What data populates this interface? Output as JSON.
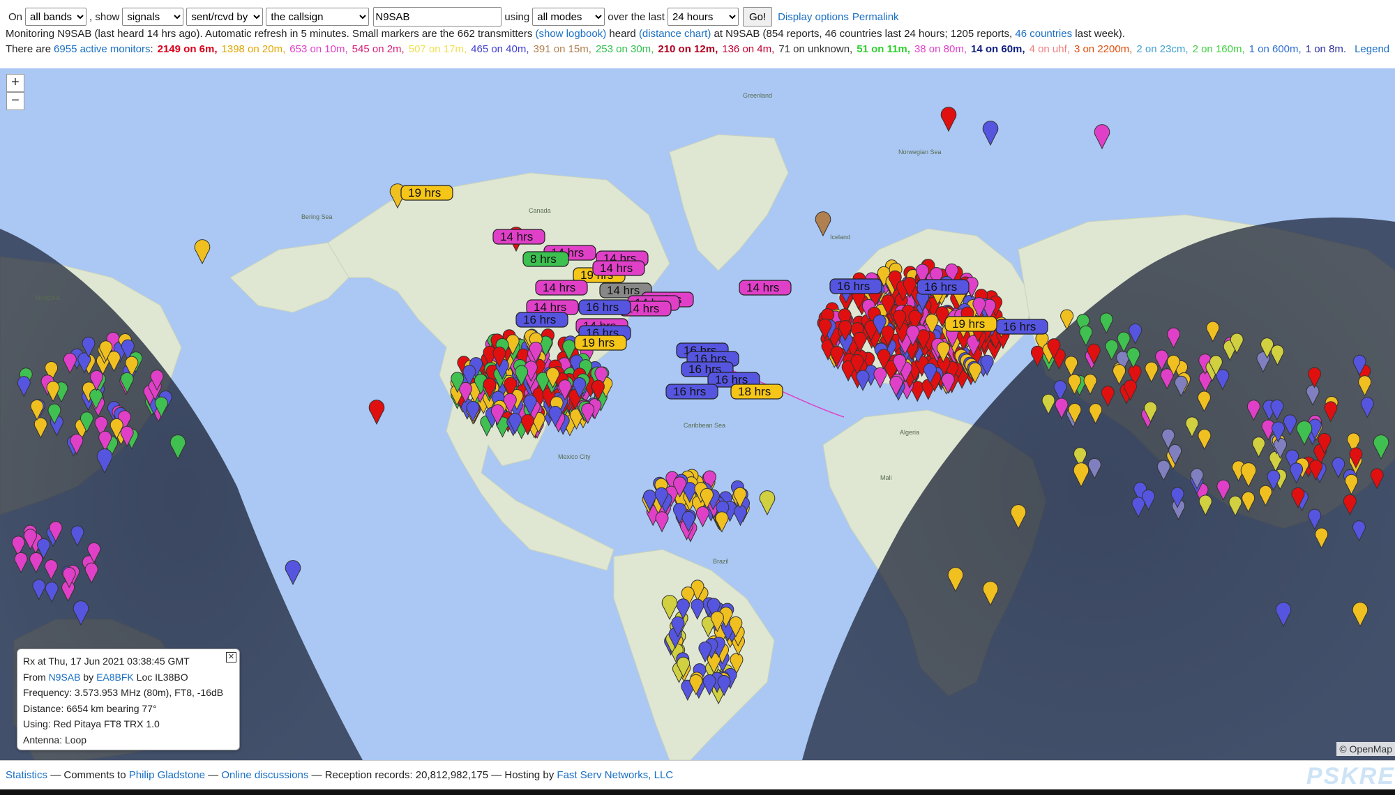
{
  "controls": {
    "on_label": "On",
    "band_value": "all bands",
    "show_label": ", show",
    "show_value": "signals",
    "direction_value": "sent/rcvd by",
    "target_value": "the callsign",
    "callsign_value": "N9SAB",
    "using_label": "using",
    "mode_value": "all modes",
    "over_label": "over the last",
    "period_value": "24 hours",
    "go_label": "Go!",
    "display_options": "Display options",
    "permalink": "Permalink"
  },
  "status": {
    "part1": "Monitoring N9SAB (last heard 14 hrs ago). Automatic refresh in 5 minutes. Small markers are the 662 transmitters",
    "show_logbook": "(show logbook)",
    "part2": "heard",
    "distance_chart": "(distance chart)",
    "part3": "at N9SAB (854 reports, 46 countries last 24 hours; 1205 reports,",
    "countries_link": "46 countries",
    "part4": "last week)."
  },
  "monitors": {
    "prefix": "There are",
    "active_link": "6955 active monitors",
    "colon": ":",
    "legend": "Legend",
    "bands": [
      {
        "text": "2149 on 6m,",
        "color": "#d9001b",
        "bold": true
      },
      {
        "text": "1398 on 20m,",
        "color": "#e3a500",
        "bold": false
      },
      {
        "text": "653 on 10m,",
        "color": "#e040c8",
        "bold": false
      },
      {
        "text": "545 on 2m,",
        "color": "#d4207a",
        "bold": false
      },
      {
        "text": "507 on 17m,",
        "color": "#f0e050",
        "bold": false
      },
      {
        "text": "465 on 40m,",
        "color": "#4040d0",
        "bold": false
      },
      {
        "text": "391 on 15m,",
        "color": "#b08050",
        "bold": false
      },
      {
        "text": "253 on 30m,",
        "color": "#30c050",
        "bold": false
      },
      {
        "text": "210 on 12m,",
        "color": "#b00020",
        "bold": true
      },
      {
        "text": "136 on 4m,",
        "color": "#c00030",
        "bold": false
      },
      {
        "text": "71 on unknown,",
        "color": "#333333",
        "bold": false
      },
      {
        "text": "51 on 11m,",
        "color": "#30d030",
        "bold": true
      },
      {
        "text": "38 on 80m,",
        "color": "#e040c8",
        "bold": false
      },
      {
        "text": "14 on 60m,",
        "color": "#102080",
        "bold": true
      },
      {
        "text": "4 on uhf,",
        "color": "#f08080",
        "bold": false
      },
      {
        "text": "3 on 2200m,",
        "color": "#e05010",
        "bold": false
      },
      {
        "text": "2 on 23cm,",
        "color": "#40a0d0",
        "bold": false
      },
      {
        "text": "2 on 160m,",
        "color": "#40d040",
        "bold": false
      },
      {
        "text": "1 on 600m,",
        "color": "#3070d0",
        "bold": false
      },
      {
        "text": "1 on 8m.",
        "color": "#3030a0",
        "bold": false
      }
    ]
  },
  "map": {
    "zoom_in": "+",
    "zoom_out": "−",
    "geo_labels": {
      "greenland": "Greenland",
      "canada": "Canada",
      "iceland": "Iceland",
      "norwegian_sea": "Norwegian Sea",
      "bering_sea": "Bering Sea",
      "mongolia": "Mongolia",
      "algeria": "Algeria",
      "mali": "Mali",
      "brazil": "Brazil",
      "mexico": "Mexico City",
      "caribbean": "Caribbean Sea"
    },
    "labels": [
      {
        "text": "19 hrs",
        "color": "#f5c518"
      },
      {
        "text": "19 hrs",
        "color": "#f5c518"
      },
      {
        "text": "14 hrs",
        "color": "#e040c8"
      },
      {
        "text": "14 hrs",
        "color": "#e040c8"
      },
      {
        "text": "8 hrs",
        "color": "#3cc050"
      },
      {
        "text": "14 hrs",
        "color": "#e040c8"
      },
      {
        "text": "14 hrs",
        "color": "#e040c8"
      },
      {
        "text": "14 hrs",
        "color": "#e040c8"
      },
      {
        "text": "14 hrs",
        "color": "#888888"
      },
      {
        "text": "14 hrs",
        "color": "#e040c8"
      },
      {
        "text": "14 hrs",
        "color": "#e040c8"
      },
      {
        "text": "14 hrs",
        "color": "#e040c8"
      },
      {
        "text": "14 hrs",
        "color": "#e040c8"
      },
      {
        "text": "16 hrs",
        "color": "#5555e0"
      },
      {
        "text": "16 hrs",
        "color": "#5555e0"
      },
      {
        "text": "14 hrs",
        "color": "#e040c8"
      },
      {
        "text": "16 hrs",
        "color": "#5555e0"
      },
      {
        "text": "19 hrs",
        "color": "#f5c518"
      },
      {
        "text": "16 hrs",
        "color": "#5555e0"
      },
      {
        "text": "16 hrs",
        "color": "#5555e0"
      },
      {
        "text": "16 hrs",
        "color": "#5555e0"
      },
      {
        "text": "16 hrs",
        "color": "#5555e0"
      },
      {
        "text": "18 hrs",
        "color": "#f5c518"
      },
      {
        "text": "16 hrs",
        "color": "#5555e0"
      },
      {
        "text": "14 hrs",
        "color": "#e040c8"
      },
      {
        "text": "16 hrs",
        "color": "#5555e0"
      },
      {
        "text": "16 hrs",
        "color": "#5555e0"
      },
      {
        "text": "16 hrs",
        "color": "#5555e0"
      },
      {
        "text": "19 hrs",
        "color": "#f5c518"
      }
    ]
  },
  "popup": {
    "rx_line": "Rx at Thu, 17 Jun 2021 03:38:45 GMT",
    "from_label": "From",
    "from_call": "N9SAB",
    "by_label": "by",
    "by_call": "EA8BFK",
    "loc": "Loc IL38BO",
    "frequency": "Frequency: 3.573.953 MHz (80m), FT8, -16dB",
    "distance": "Distance: 6654 km bearing 77°",
    "using": "Using: Red Pitaya FT8 TRX 1.0",
    "antenna": "Antenna: Loop"
  },
  "attribution": "© OpenMap",
  "footer": {
    "statistics": "Statistics",
    "comments_label": "— Comments to",
    "philip": "Philip Gladstone",
    "sep1": "—",
    "online": "Online discussions",
    "records": "— Reception records: 20,812,982,175 — Hosting by",
    "hosting": "Fast Serv Networks, LLC"
  },
  "brand": "PSKRE"
}
